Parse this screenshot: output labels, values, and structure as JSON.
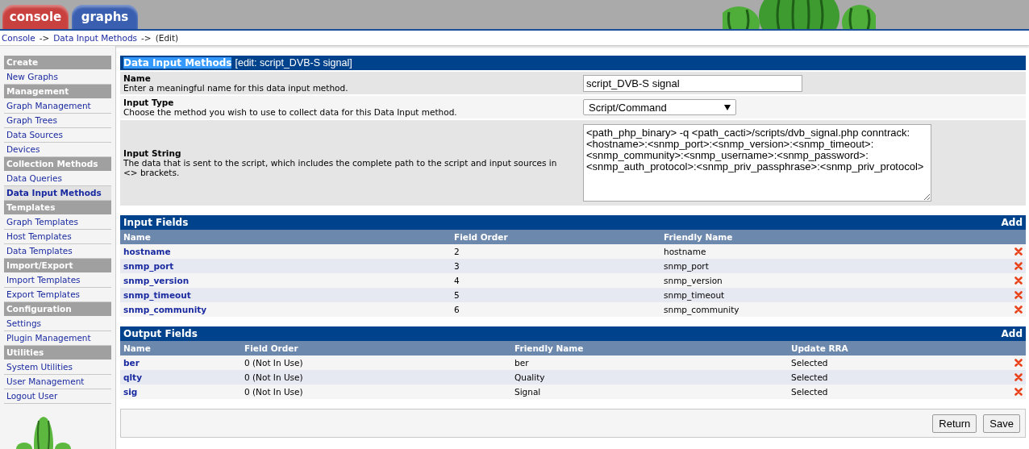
{
  "tabs": [
    {
      "label": "console",
      "color": "#c8413f"
    },
    {
      "label": "graphs",
      "color": "#3a5fb0"
    }
  ],
  "breadcrumb": [
    {
      "text": "Console",
      "kind": "link"
    },
    {
      "text": "->",
      "kind": "sep"
    },
    {
      "text": "Data Input Methods",
      "kind": "link"
    },
    {
      "text": "->",
      "kind": "sep"
    },
    {
      "text": "(Edit)",
      "kind": "text"
    }
  ],
  "sidebar": [
    {
      "kind": "header",
      "label": "Create"
    },
    {
      "kind": "item",
      "label": "New Graphs",
      "selected": false
    },
    {
      "kind": "header",
      "label": "Management"
    },
    {
      "kind": "item",
      "label": "Graph Management",
      "selected": false
    },
    {
      "kind": "item",
      "label": "Graph Trees",
      "selected": false
    },
    {
      "kind": "item",
      "label": "Data Sources",
      "selected": false
    },
    {
      "kind": "item",
      "label": "Devices",
      "selected": false
    },
    {
      "kind": "header",
      "label": "Collection Methods"
    },
    {
      "kind": "item",
      "label": "Data Queries",
      "selected": false
    },
    {
      "kind": "item",
      "label": "Data Input Methods",
      "selected": true
    },
    {
      "kind": "header",
      "label": "Templates"
    },
    {
      "kind": "item",
      "label": "Graph Templates",
      "selected": false
    },
    {
      "kind": "item",
      "label": "Host Templates",
      "selected": false
    },
    {
      "kind": "item",
      "label": "Data Templates",
      "selected": false
    },
    {
      "kind": "header",
      "label": "Import/Export"
    },
    {
      "kind": "item",
      "label": "Import Templates",
      "selected": false
    },
    {
      "kind": "item",
      "label": "Export Templates",
      "selected": false
    },
    {
      "kind": "header",
      "label": "Configuration"
    },
    {
      "kind": "item",
      "label": "Settings",
      "selected": false
    },
    {
      "kind": "item",
      "label": "Plugin Management",
      "selected": false
    },
    {
      "kind": "header",
      "label": "Utilities"
    },
    {
      "kind": "item",
      "label": "System Utilities",
      "selected": false
    },
    {
      "kind": "item",
      "label": "User Management",
      "selected": false
    },
    {
      "kind": "item",
      "label": "Logout User",
      "selected": false
    }
  ],
  "form": {
    "title": "Data Input Methods",
    "title_highlighted": true,
    "subtitle": "[edit: script_DVB-S signal]",
    "fields": [
      {
        "kind": "text",
        "label": "Name",
        "description": "Enter a meaningful name for this data input method.",
        "value": "script_DVB-S signal"
      },
      {
        "kind": "select",
        "label": "Input Type",
        "description": "Choose the method you wish to use to collect data for this Data Input method.",
        "value": "Script/Command"
      },
      {
        "kind": "textarea",
        "label": "Input String",
        "description": "The data that is sent to the script, which includes the complete path to the script and input sources in <> brackets.",
        "value": "<path_php_binary> -q <path_cacti>/scripts/dvb_signal.php conntrack:<hostname>:<snmp_port>:<snmp_version>:<snmp_timeout>:<snmp_community>:<snmp_username>:<snmp_password>:<snmp_auth_protocol>:<snmp_priv_passphrase>:<snmp_priv_protocol>"
      }
    ]
  },
  "tables": [
    {
      "title": "Input Fields",
      "action": "Add",
      "columns": [
        "Name",
        "Field Order",
        "Friendly Name"
      ],
      "rows": [
        [
          "hostname",
          "2",
          "hostname"
        ],
        [
          "snmp_port",
          "3",
          "snmp_port"
        ],
        [
          "snmp_version",
          "4",
          "snmp_version"
        ],
        [
          "snmp_timeout",
          "5",
          "snmp_timeout"
        ],
        [
          "snmp_community",
          "6",
          "snmp_community"
        ]
      ]
    },
    {
      "title": "Output Fields",
      "action": "Add",
      "columns": [
        "Name",
        "Field Order",
        "Friendly Name",
        "Update RRA"
      ],
      "rows": [
        [
          "ber",
          "0 (Not In Use)",
          "ber",
          "Selected"
        ],
        [
          "qlty",
          "0 (Not In Use)",
          "Quality",
          "Selected"
        ],
        [
          "sig",
          "0 (Not In Use)",
          "Signal",
          "Selected"
        ]
      ]
    }
  ],
  "buttons": [
    "Return",
    "Save"
  ]
}
